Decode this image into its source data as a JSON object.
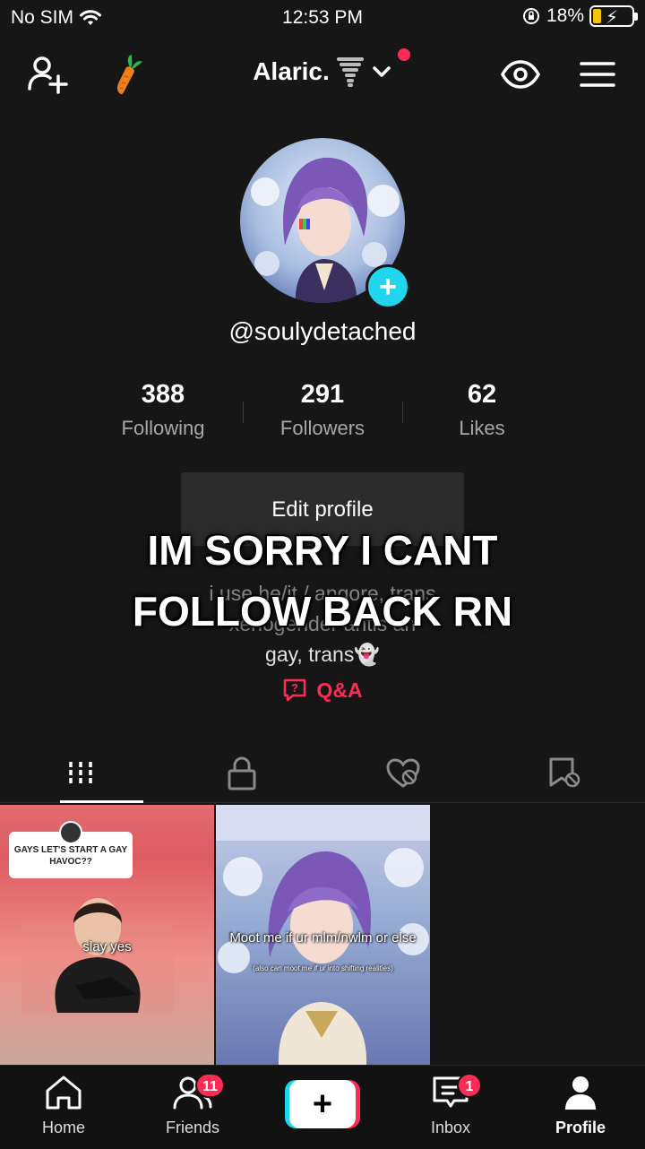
{
  "status_bar": {
    "carrier": "No SIM",
    "time": "12:53 PM",
    "battery": "18%"
  },
  "header": {
    "title": "Alaric."
  },
  "profile": {
    "handle": "@soulydetached",
    "stats": [
      {
        "value": "388",
        "label": "Following"
      },
      {
        "value": "291",
        "label": "Followers"
      },
      {
        "value": "62",
        "label": "Likes"
      }
    ],
    "edit_label": "Edit profile",
    "bio_line1": "i use he/it / angore, trans",
    "bio_line2": "xenogender antis an",
    "bio_line3": "gay, trans👻",
    "qa_label": "Q&A"
  },
  "overlay": {
    "line1": "IM SORRY I CANT",
    "line2": "FOLLOW BACK RN"
  },
  "videos": [
    {
      "question": "GAYS LET'S START A GAY HAVOC??",
      "caption": "slay yes"
    },
    {
      "caption": "Moot me if ur mlm/nwlm or else",
      "subcaption": "(also can moot me if ur into shifting realities)"
    }
  ],
  "bottom_nav": {
    "home": "Home",
    "friends": "Friends",
    "friends_badge": "11",
    "inbox": "Inbox",
    "inbox_badge": "1",
    "profile": "Profile"
  },
  "colors": {
    "accent": "#fe2c55",
    "secondary": "#20d5ec",
    "background": "#161616"
  }
}
